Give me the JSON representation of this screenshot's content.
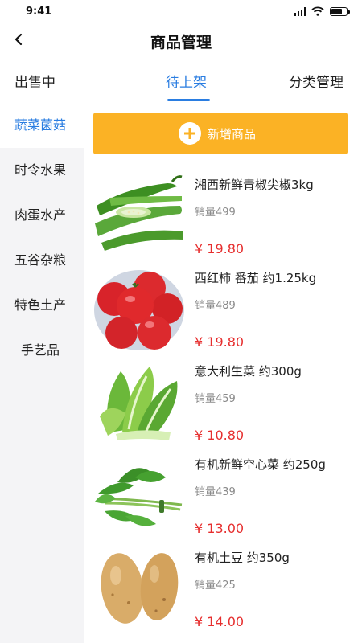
{
  "status_bar": {
    "time": "9:41"
  },
  "header": {
    "title": "商品管理"
  },
  "tabs": [
    {
      "label": "出售中"
    },
    {
      "label": "待上架"
    },
    {
      "label": "分类管理"
    }
  ],
  "categories": [
    {
      "label": "蔬菜菌菇"
    },
    {
      "label": "时令水果"
    },
    {
      "label": "肉蛋水产"
    },
    {
      "label": "五谷杂粮"
    },
    {
      "label": "特色土产"
    },
    {
      "label": "手艺品"
    }
  ],
  "add_button": {
    "label": "新增商品"
  },
  "products": [
    {
      "name": "湘西新鲜青椒尖椒3kg",
      "sales": "销量499",
      "price": "¥ 19.80",
      "image": "green-pepper"
    },
    {
      "name": "西红柿 番茄 约1.25kg",
      "sales": "销量489",
      "price": "¥ 19.80",
      "image": "tomato"
    },
    {
      "name": "意大利生菜 约300g",
      "sales": "销量459",
      "price": "¥ 10.80",
      "image": "lettuce"
    },
    {
      "name": "有机新鲜空心菜 约250g",
      "sales": "销量439",
      "price": "¥ 13.00",
      "image": "water-spinach"
    },
    {
      "name": "有机土豆 约350g",
      "sales": "销量425",
      "price": "¥ 14.00",
      "image": "potato"
    }
  ],
  "colors": {
    "accent": "#2a7de1",
    "button": "#fbb225",
    "price": "#e62e2e"
  }
}
